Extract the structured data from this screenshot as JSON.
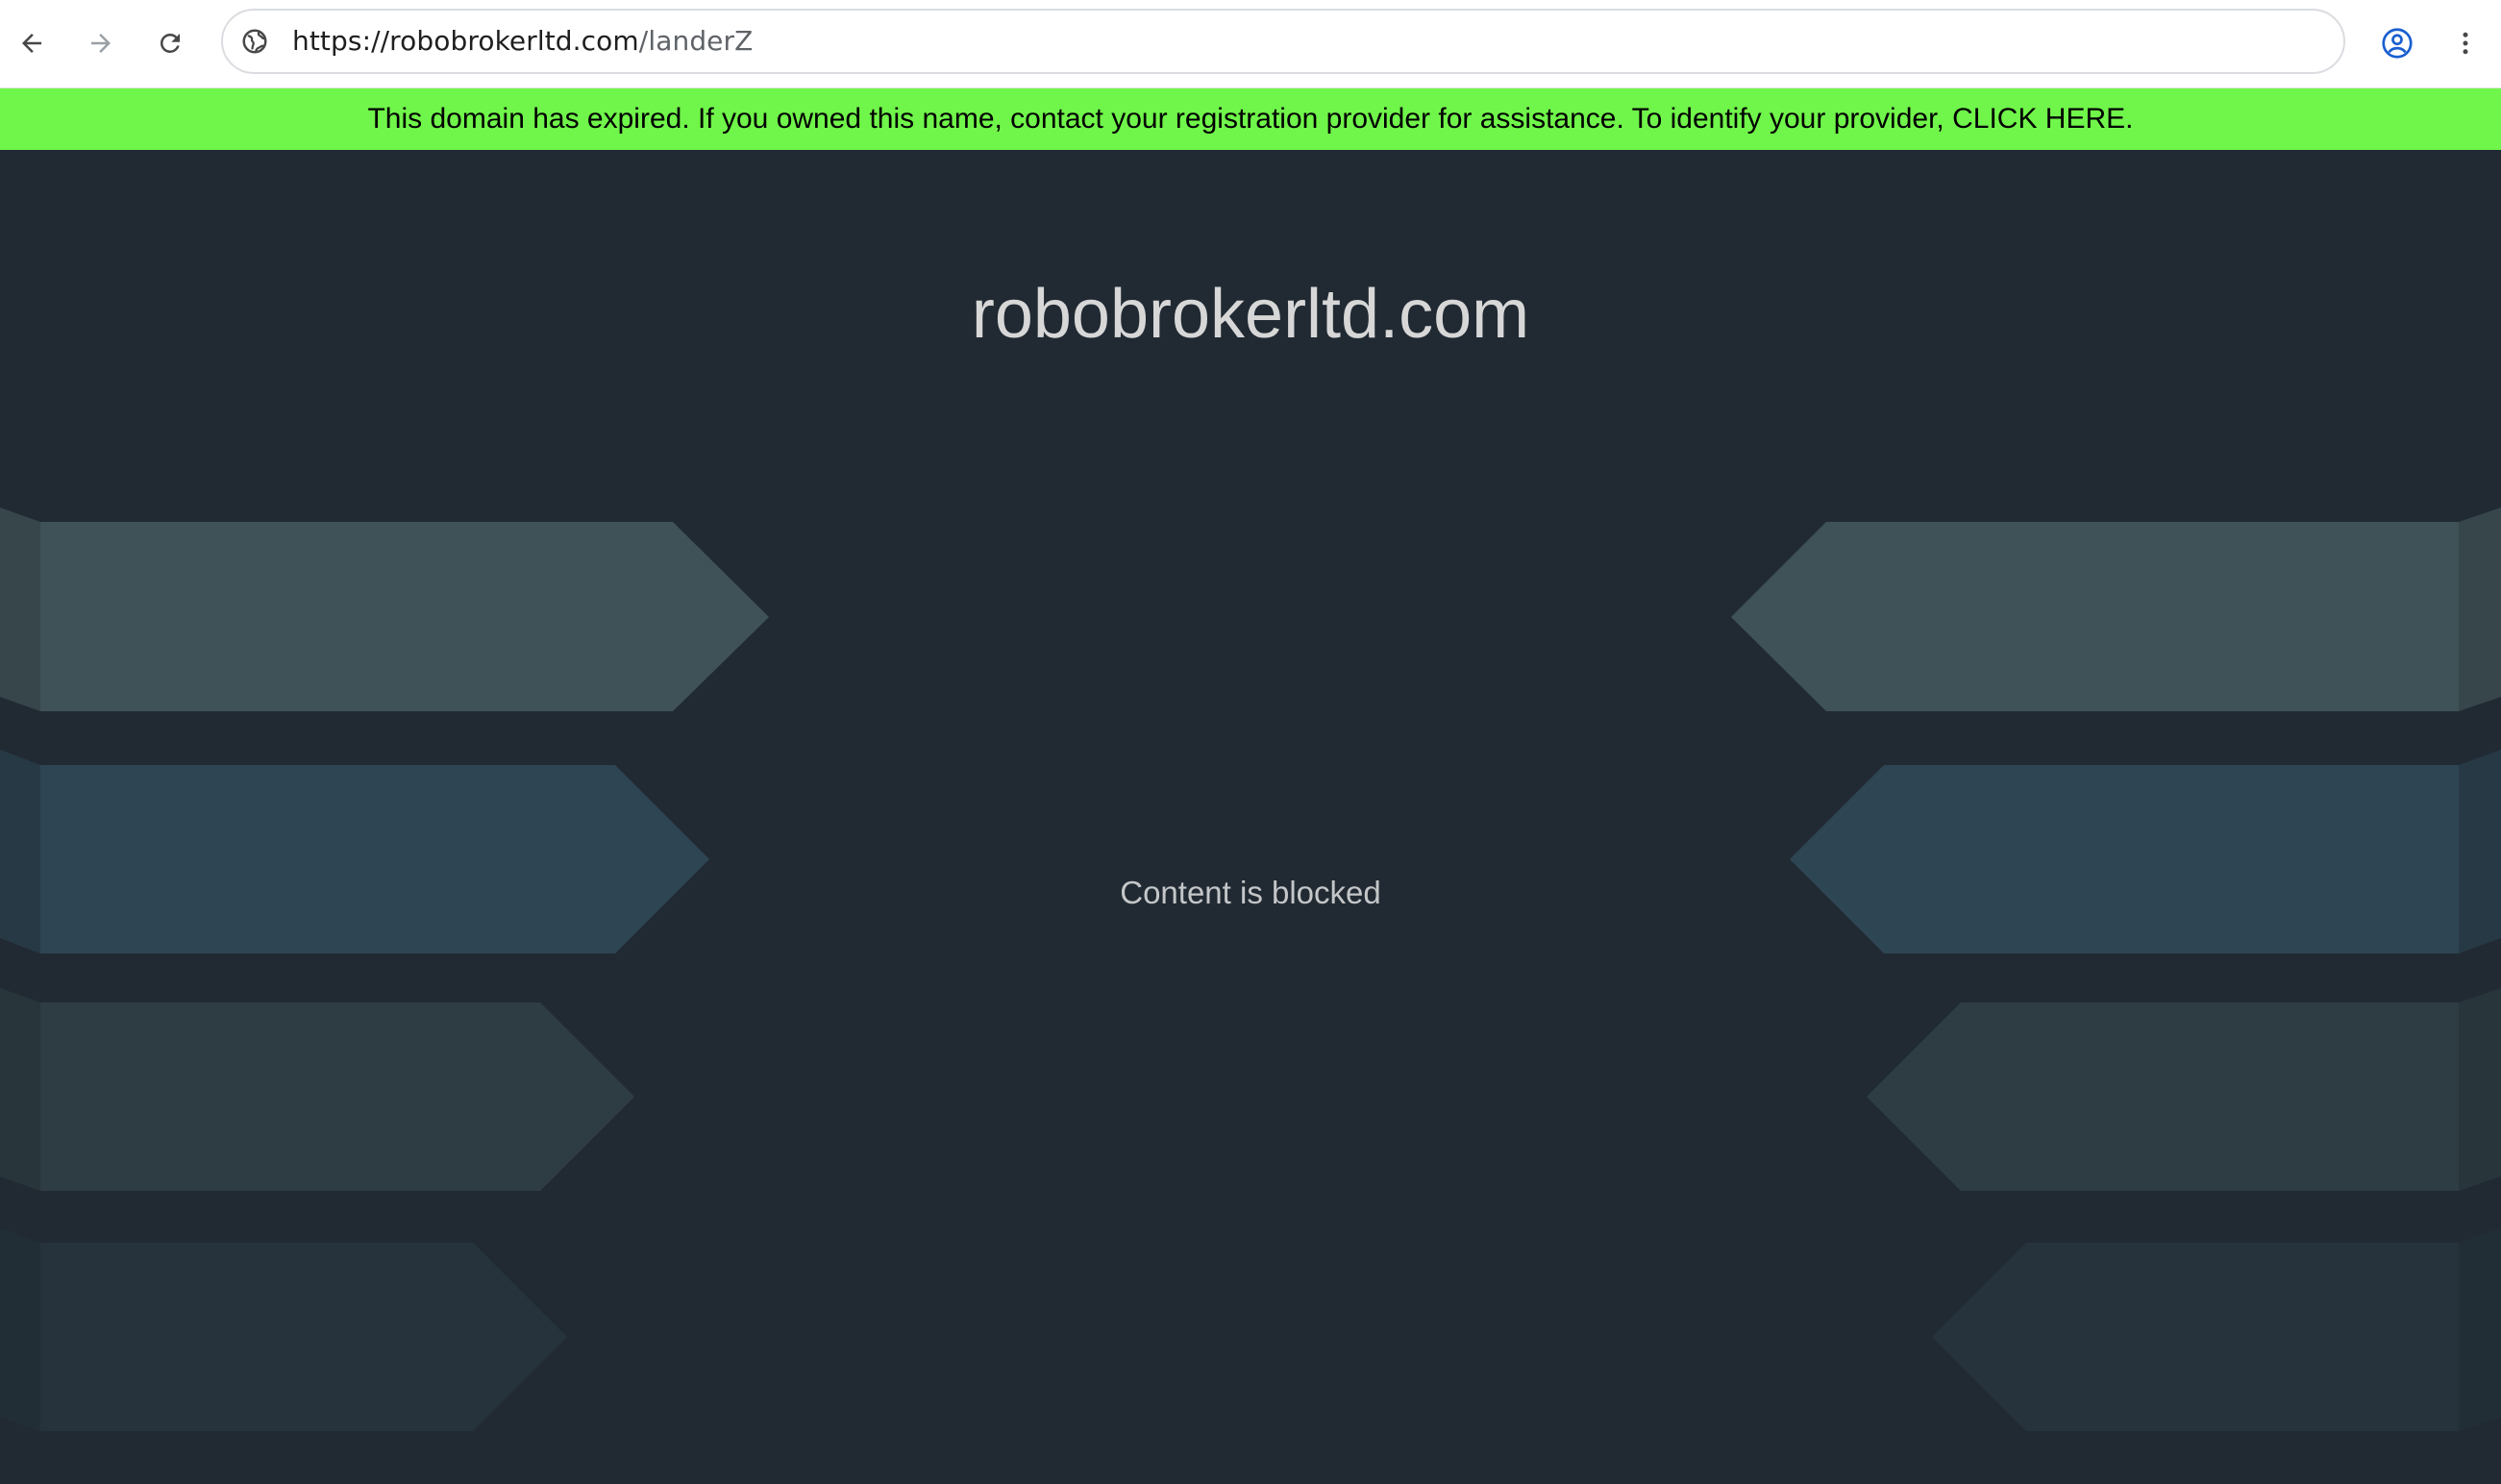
{
  "browser": {
    "url_host": "https://robobrokerltd.com",
    "url_path": "/landerZ",
    "icons": [
      "back-icon",
      "forward-icon",
      "reload-icon",
      "site-info-icon",
      "profile-icon",
      "more-vertical-icon"
    ]
  },
  "banner": {
    "text": "This domain has expired. If you owned this name, contact your registration provider for assistance. To identify your provider,",
    "link_label": "CLICK HERE.",
    "color": "#70f54a"
  },
  "page": {
    "title": "robobrokerltd.com",
    "status": "Content is blocked",
    "background": "#212a33"
  }
}
